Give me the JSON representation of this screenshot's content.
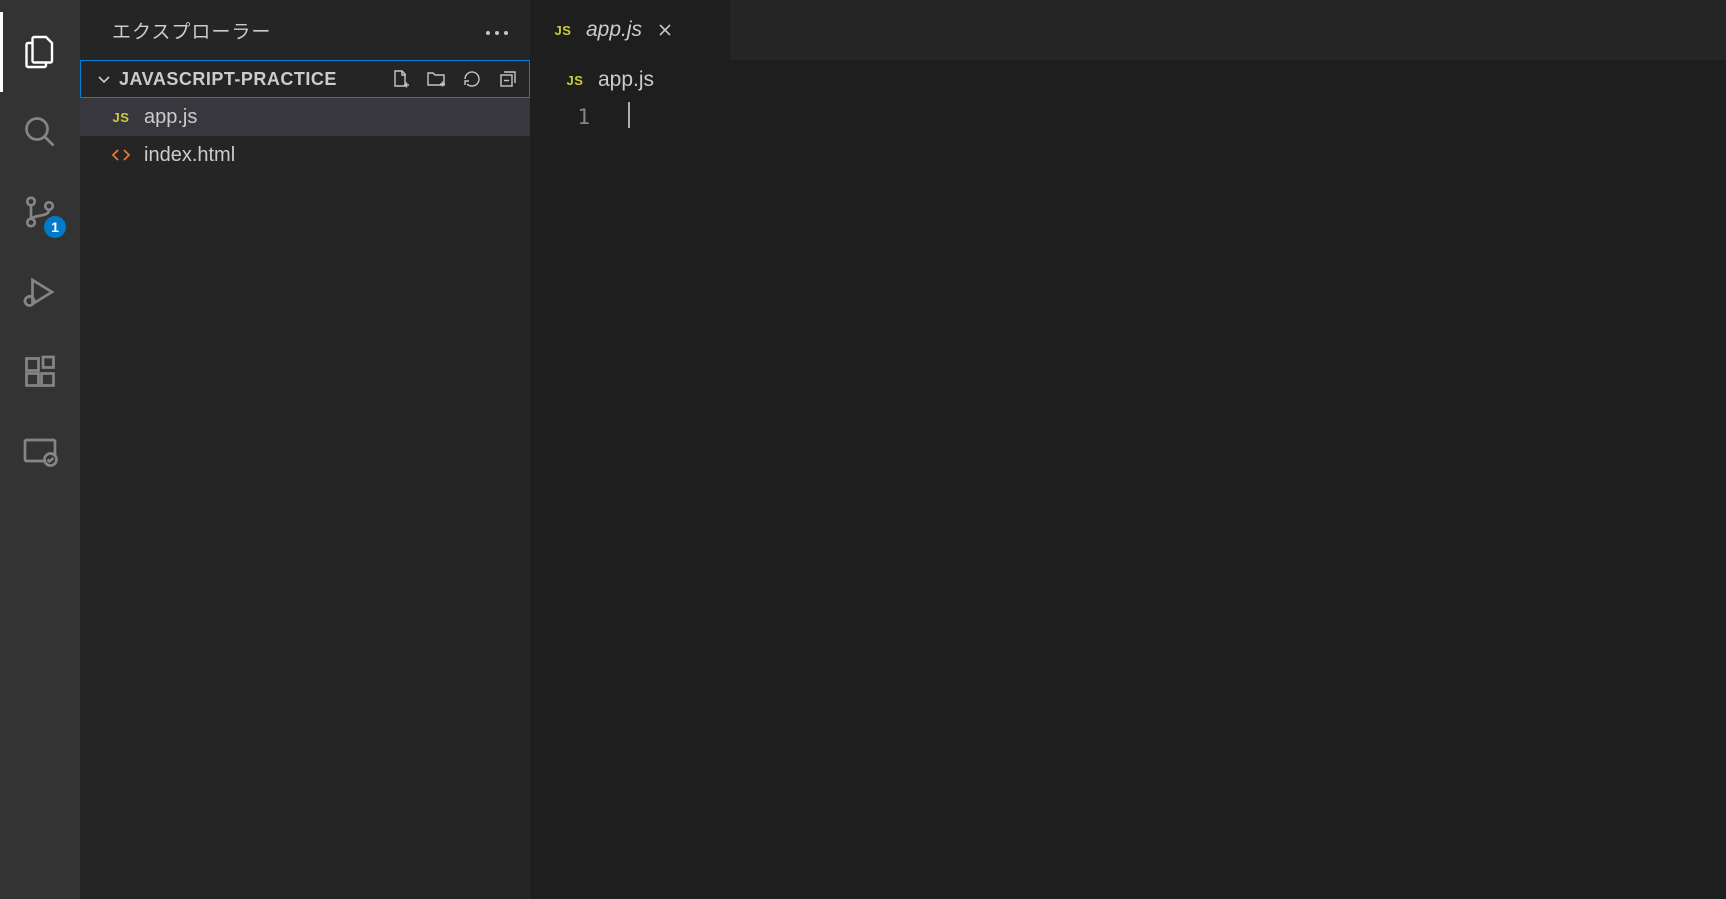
{
  "activityBar": {
    "scmBadge": "1"
  },
  "sidebar": {
    "title": "エクスプローラー",
    "folder": {
      "name": "JAVASCRIPT-PRACTICE"
    },
    "files": [
      {
        "iconType": "js",
        "iconText": "JS",
        "label": "app.js",
        "selected": true
      },
      {
        "iconType": "html",
        "iconText": "<>",
        "label": "index.html",
        "selected": false
      }
    ]
  },
  "tabs": [
    {
      "iconText": "JS",
      "label": "app.js",
      "italic": true,
      "active": true
    }
  ],
  "breadcrumb": {
    "iconText": "JS",
    "label": "app.js"
  },
  "editor": {
    "lineNumbers": [
      "1"
    ],
    "lines": [
      ""
    ]
  }
}
